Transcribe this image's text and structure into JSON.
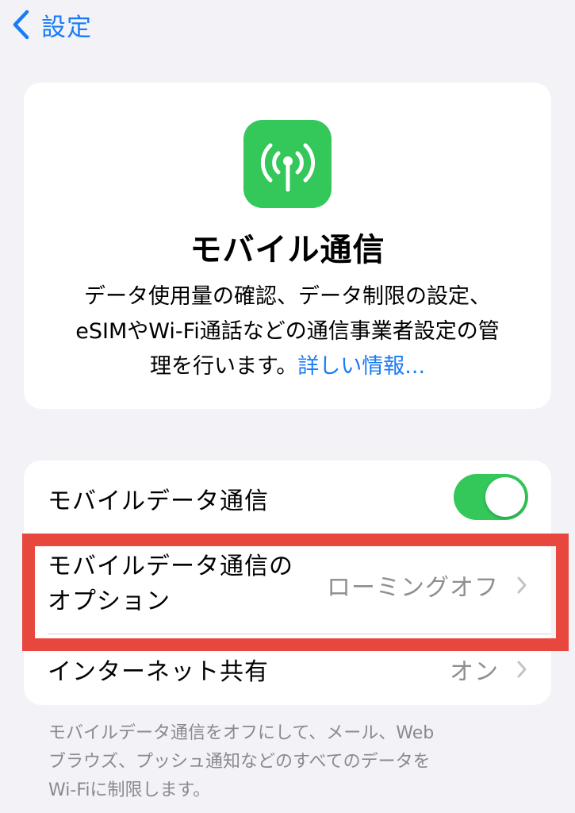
{
  "nav": {
    "back_label": "設定"
  },
  "info": {
    "title": "モバイル通信",
    "description_line1": "データ使用量の確認、データ制限の設定、",
    "description_line2": "eSIMやWi-Fi通話などの通信事業者設定の管",
    "description_line3": "理を行います。",
    "link_label": "詳しい情報..."
  },
  "list": {
    "mobile_data": {
      "label": "モバイルデータ通信",
      "enabled": true
    },
    "options": {
      "label_line1": "モバイルデータ通信の",
      "label_line2": "オプション",
      "value": "ローミングオフ"
    },
    "hotspot": {
      "label": "インターネット共有",
      "value": "オン"
    }
  },
  "footer": {
    "line1": "モバイルデータ通信をオフにして、メール、Web",
    "line2": "ブラウズ、プッシュ通知などのすべてのデータを",
    "line3": "Wi-Fiに制限します。"
  },
  "colors": {
    "accent": "#1a7cf5",
    "toggle_on": "#34c759",
    "highlight": "#e8473d",
    "background": "#f2f2f7"
  },
  "icons": [
    "chevron-left-icon",
    "antenna-icon",
    "chevron-right-icon"
  ]
}
